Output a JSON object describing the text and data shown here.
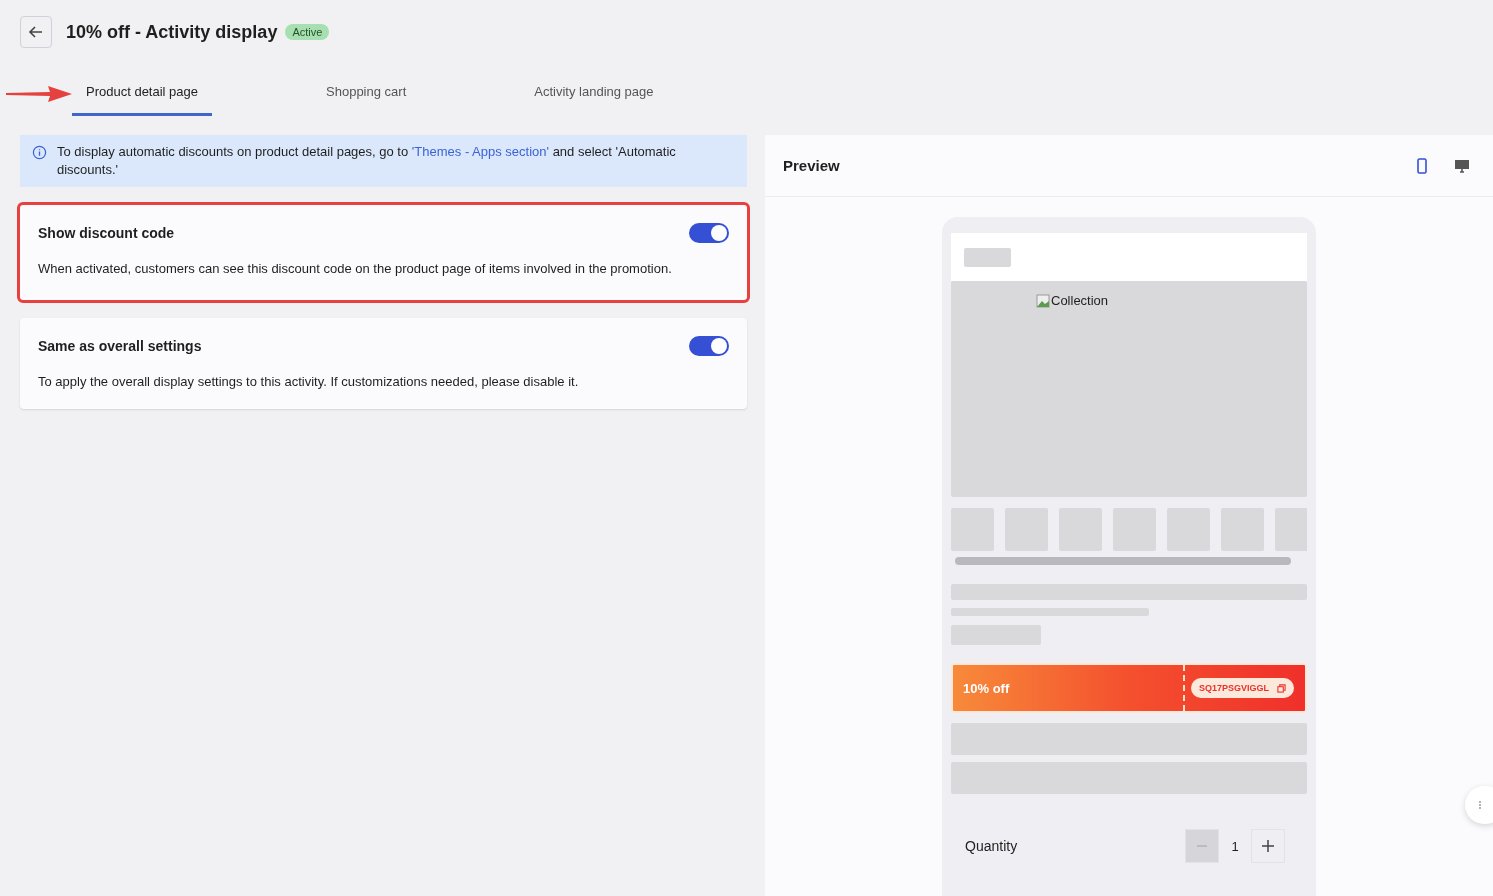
{
  "header": {
    "title": "10% off - Activity display",
    "status": "Active"
  },
  "tabs": [
    {
      "label": "Product detail page",
      "selected": true
    },
    {
      "label": "Shopping cart",
      "selected": false
    },
    {
      "label": "Activity landing page",
      "selected": false
    }
  ],
  "notice": {
    "text_before": "To display automatic discounts on product detail pages, go to ",
    "link": "'Themes - Apps section'",
    "text_after": " and select 'Automatic discounts.'"
  },
  "settings": [
    {
      "title": "Show discount code",
      "description": "When activated, customers can see this discount code on the product page of items involved in the promotion.",
      "on": true,
      "highlighted": true
    },
    {
      "title": "Same as overall settings",
      "description": "To apply the overall display settings to this activity. If customizations needed, please disable it.",
      "on": true,
      "highlighted": false
    }
  ],
  "preview": {
    "title": "Preview",
    "devices": [
      {
        "kind": "mobile",
        "selected": true
      },
      {
        "kind": "desktop",
        "selected": false
      }
    ],
    "image_alt": "Collection",
    "coupon": {
      "label": "10% off",
      "code": "SQ17PSGVIGGL"
    },
    "quantity": {
      "label": "Quantity",
      "value": "1",
      "minus_disabled": true
    }
  }
}
